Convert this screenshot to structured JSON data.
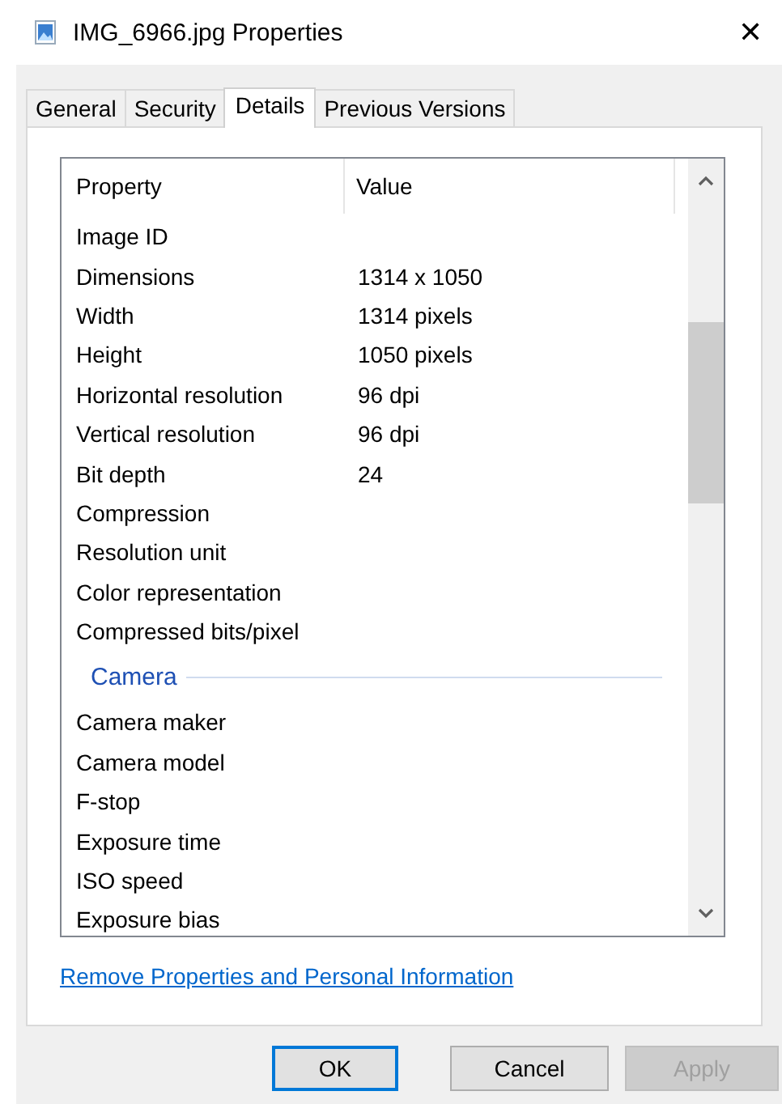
{
  "window": {
    "title": "IMG_6966.jpg Properties",
    "close": "✕"
  },
  "tabs": [
    {
      "label": "General",
      "selected": false
    },
    {
      "label": "Security",
      "selected": false
    },
    {
      "label": "Details",
      "selected": true
    },
    {
      "label": "Previous Versions",
      "selected": false
    }
  ],
  "table": {
    "columns": [
      "Property",
      "Value"
    ],
    "rows": [
      {
        "kind": "row",
        "property": "Image ID"
      },
      {
        "kind": "row",
        "property": "Dimensions",
        "value": "1314 x 1050"
      },
      {
        "kind": "row",
        "property": "Width",
        "value": "1314 pixels"
      },
      {
        "kind": "row",
        "property": "Height",
        "value": "1050 pixels"
      },
      {
        "kind": "row",
        "property": "Horizontal resolution",
        "value": "96 dpi"
      },
      {
        "kind": "row",
        "property": "Vertical resolution",
        "value": "96 dpi"
      },
      {
        "kind": "row",
        "property": "Bit depth",
        "value": "24"
      },
      {
        "kind": "row",
        "property": "Compression"
      },
      {
        "kind": "row",
        "property": "Resolution unit"
      },
      {
        "kind": "row",
        "property": "Color representation"
      },
      {
        "kind": "row",
        "property": "Compressed bits/pixel"
      },
      {
        "kind": "group",
        "property": "Camera"
      },
      {
        "kind": "row",
        "property": "Camera maker"
      },
      {
        "kind": "row",
        "property": "Camera model"
      },
      {
        "kind": "row",
        "property": "F-stop"
      },
      {
        "kind": "row",
        "property": "Exposure time"
      },
      {
        "kind": "row",
        "property": "ISO speed"
      },
      {
        "kind": "row",
        "property": "Exposure bias"
      }
    ]
  },
  "link": "Remove Properties and Personal Information",
  "buttons": [
    {
      "label": "OK",
      "default": true,
      "disabled": false
    },
    {
      "label": "Cancel",
      "default": false,
      "disabled": false
    },
    {
      "label": "Apply",
      "default": false,
      "disabled": true
    }
  ]
}
